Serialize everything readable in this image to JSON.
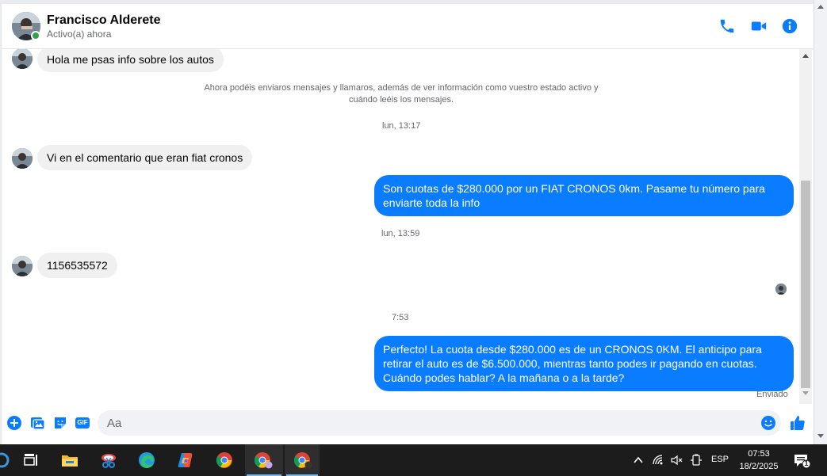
{
  "header": {
    "contact_name": "Francisco Alderete",
    "status": "Activo(a) ahora",
    "icons": [
      "phone-icon",
      "video-camera-icon",
      "info-icon"
    ],
    "accent_color": "#0a7cff"
  },
  "messages": {
    "first_incoming": "Hola me psas info sobre los autos",
    "system_note": "Ahora podéis enviaros mensajes y llamaros, además de ver información como vuestro estado activo y cuándo leéis los mensajes.",
    "time_1": "lun, 13:17",
    "incoming_1": "Vi en el comentario que eran fiat cronos",
    "outgoing_1": "Son cuotas de $280.000 por un FIAT CRONOS 0km. Pasame tu número para enviarte toda la info",
    "time_2": "lun, 13:59",
    "incoming_2": "1156535572",
    "time_3": "7:53",
    "outgoing_2": "Perfecto! La cuota desde $280.000 es de un CRONOS 0KM. El anticipo para retirar el auto es de $6.500.000, mientras tanto podes ir pagando en cuotas. Cuándo podes hablar? A la mañana o a la tarde?",
    "sent_status": "Enviado"
  },
  "composer": {
    "placeholder": "Aa",
    "icons": [
      "plus-circle-icon",
      "image-icon",
      "sticker-icon",
      "gif-icon",
      "emoji-icon",
      "thumbs-up-icon"
    ],
    "gif_label": "GIF"
  },
  "taskbar": {
    "apps": [
      "task-view-icon",
      "file-explorer-icon",
      "snipping-tool-icon",
      "edge-icon",
      "copilot-icon",
      "chrome-icon",
      "chrome-profile-1-icon",
      "chrome-profile-2-icon"
    ],
    "language": "ESP",
    "time": "07:53",
    "date": "18/2/2025",
    "notification_count": "1"
  }
}
